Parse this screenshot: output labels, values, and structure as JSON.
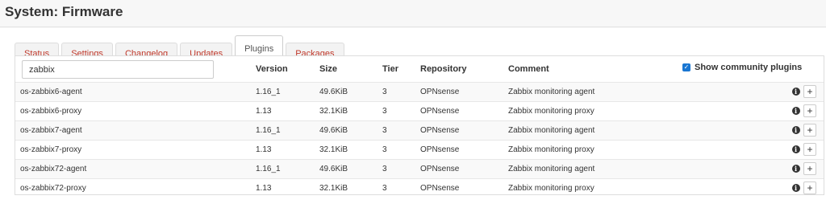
{
  "page_title": "System: Firmware",
  "tabs": [
    "Status",
    "Settings",
    "Changelog",
    "Updates",
    "Plugins",
    "Packages"
  ],
  "active_tab": "Plugins",
  "search": {
    "value": "zabbix"
  },
  "columns": {
    "version": "Version",
    "size": "Size",
    "tier": "Tier",
    "repository": "Repository",
    "comment": "Comment"
  },
  "show_community": {
    "label": "Show community plugins",
    "checked": true
  },
  "plugins": [
    {
      "name": "os-zabbix6-agent",
      "version": "1.16_1",
      "size": "49.6KiB",
      "tier": "3",
      "repository": "OPNsense",
      "comment": "Zabbix monitoring agent"
    },
    {
      "name": "os-zabbix6-proxy",
      "version": "1.13",
      "size": "32.1KiB",
      "tier": "3",
      "repository": "OPNsense",
      "comment": "Zabbix monitoring proxy"
    },
    {
      "name": "os-zabbix7-agent",
      "version": "1.16_1",
      "size": "49.6KiB",
      "tier": "3",
      "repository": "OPNsense",
      "comment": "Zabbix monitoring agent"
    },
    {
      "name": "os-zabbix7-proxy",
      "version": "1.13",
      "size": "32.1KiB",
      "tier": "3",
      "repository": "OPNsense",
      "comment": "Zabbix monitoring proxy"
    },
    {
      "name": "os-zabbix72-agent",
      "version": "1.16_1",
      "size": "49.6KiB",
      "tier": "3",
      "repository": "OPNsense",
      "comment": "Zabbix monitoring agent"
    },
    {
      "name": "os-zabbix72-proxy",
      "version": "1.13",
      "size": "32.1KiB",
      "tier": "3",
      "repository": "OPNsense",
      "comment": "Zabbix monitoring proxy"
    }
  ],
  "icons": {
    "info": "info-icon",
    "install": "plus-icon",
    "checkbox": "check-icon"
  },
  "colors": {
    "tab_link": "#c0392b",
    "checkbox": "#1976d2"
  }
}
